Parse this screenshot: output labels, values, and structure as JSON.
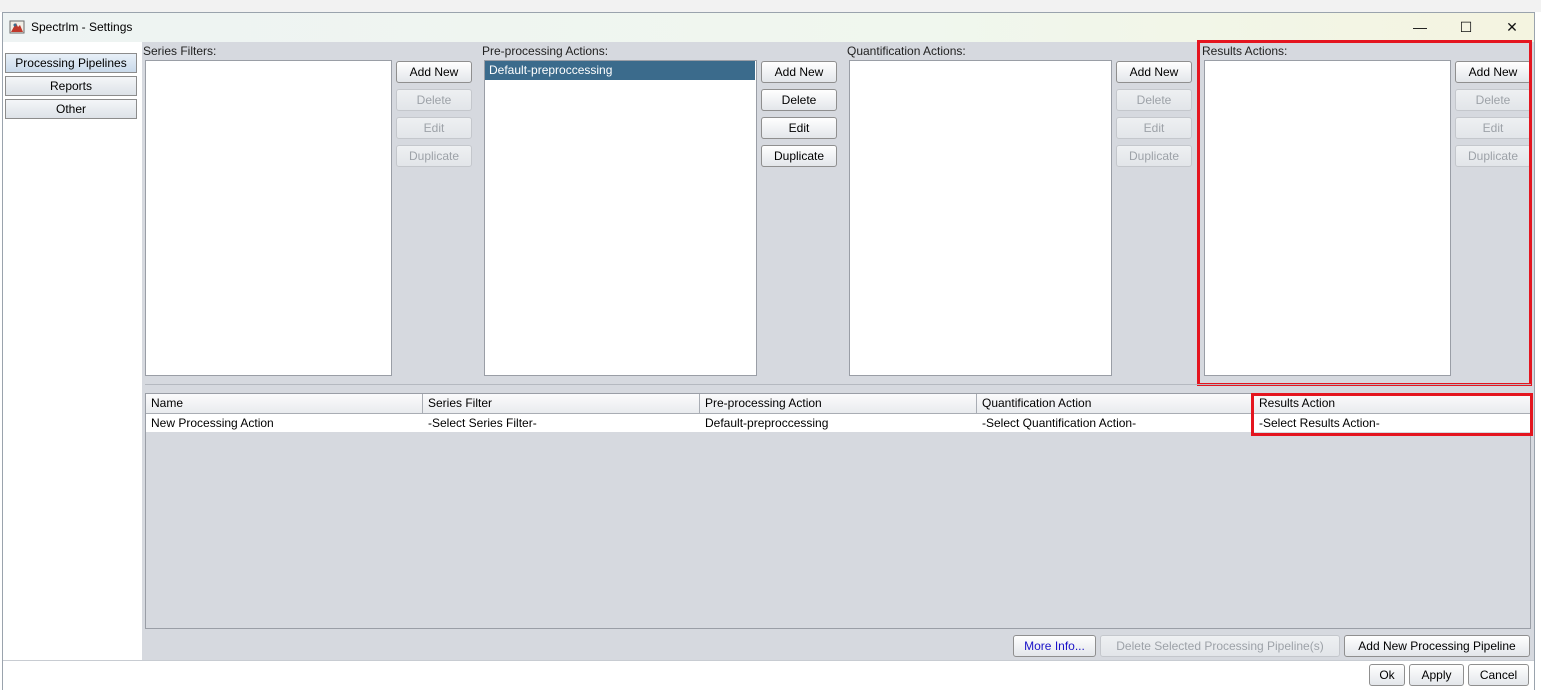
{
  "window": {
    "title": "Spectrlm - Settings",
    "controls": {
      "minimize": "—",
      "maximize": "☐",
      "close": "✕"
    }
  },
  "nav": {
    "items": [
      {
        "label": "Processing Pipelines",
        "selected": true
      },
      {
        "label": "Reports"
      },
      {
        "label": "Other"
      }
    ]
  },
  "sections": {
    "series_filters": {
      "header": "Series Filters:",
      "items": []
    },
    "preprocessing": {
      "header": "Pre-processing Actions:",
      "items": [
        "Default-preproccessing"
      ]
    },
    "quantification": {
      "header": "Quantification Actions:",
      "items": []
    },
    "results": {
      "header": "Results Actions:",
      "items": []
    }
  },
  "buttons": {
    "add_new": "Add New",
    "delete": "Delete",
    "edit": "Edit",
    "duplicate": "Duplicate"
  },
  "table": {
    "headers": [
      "Name",
      "Series Filter",
      "Pre-processing Action",
      "Quantification Action",
      "Results Action"
    ],
    "rows": [
      [
        "New Processing Action",
        "-Select Series Filter-",
        "Default-preproccessing",
        "-Select Quantification Action-",
        "-Select Results Action-"
      ]
    ]
  },
  "bottom": {
    "more_info": "More Info...",
    "delete_selected": "Delete Selected Processing Pipeline(s)",
    "add_pipeline": "Add New Processing Pipeline",
    "ok": "Ok",
    "apply": "Apply",
    "cancel": "Cancel"
  },
  "colors": {
    "highlight": "#e4151f",
    "selection": "#3b6b8c",
    "panel": "#d6d9df"
  }
}
